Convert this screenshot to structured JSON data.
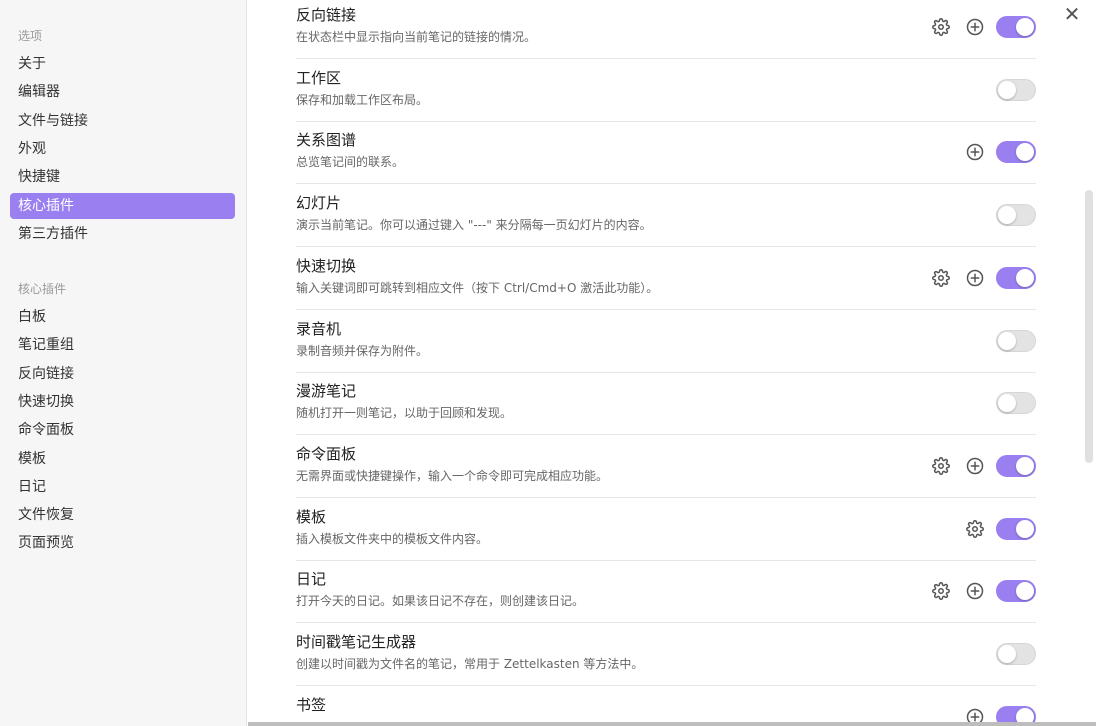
{
  "sidebar": {
    "options_heading": "选项",
    "options": [
      {
        "label": "关于",
        "active": false
      },
      {
        "label": "编辑器",
        "active": false
      },
      {
        "label": "文件与链接",
        "active": false
      },
      {
        "label": "外观",
        "active": false
      },
      {
        "label": "快捷键",
        "active": false
      },
      {
        "label": "核心插件",
        "active": true
      },
      {
        "label": "第三方插件",
        "active": false
      }
    ],
    "plugins_heading": "核心插件",
    "plugins": [
      "白板",
      "笔记重组",
      "反向链接",
      "快速切换",
      "命令面板",
      "模板",
      "日记",
      "文件恢复",
      "页面预览"
    ]
  },
  "plugins": [
    {
      "name": "反向链接",
      "desc": "在状态栏中显示指向当前笔记的链接的情况。",
      "settings": true,
      "add": true,
      "enabled": true
    },
    {
      "name": "工作区",
      "desc": "保存和加载工作区布局。",
      "settings": false,
      "add": false,
      "enabled": false
    },
    {
      "name": "关系图谱",
      "desc": "总览笔记间的联系。",
      "settings": false,
      "add": true,
      "enabled": true
    },
    {
      "name": "幻灯片",
      "desc": "演示当前笔记。你可以通过键入 \"---\" 来分隔每一页幻灯片的内容。",
      "settings": false,
      "add": false,
      "enabled": false
    },
    {
      "name": "快速切换",
      "desc": "输入关键词即可跳转到相应文件（按下 Ctrl/Cmd+O 激活此功能）。",
      "settings": true,
      "add": true,
      "enabled": true
    },
    {
      "name": "录音机",
      "desc": "录制音频并保存为附件。",
      "settings": false,
      "add": false,
      "enabled": false
    },
    {
      "name": "漫游笔记",
      "desc": "随机打开一则笔记，以助于回顾和发现。",
      "settings": false,
      "add": false,
      "enabled": false
    },
    {
      "name": "命令面板",
      "desc": "无需界面或快捷键操作，输入一个命令即可完成相应功能。",
      "settings": true,
      "add": true,
      "enabled": true
    },
    {
      "name": "模板",
      "desc": "插入模板文件夹中的模板文件内容。",
      "settings": true,
      "add": false,
      "enabled": true
    },
    {
      "name": "日记",
      "desc": "打开今天的日记。如果该日记不存在，则创建该日记。",
      "settings": true,
      "add": true,
      "enabled": true
    },
    {
      "name": "时间戳笔记生成器",
      "desc": "创建以时间戳为文件名的笔记，常用于 Zettelkasten 等方法中。",
      "settings": false,
      "add": false,
      "enabled": false
    },
    {
      "name": "书签",
      "desc": "",
      "settings": false,
      "add": true,
      "enabled": true
    }
  ],
  "icons": {
    "close": "close-icon",
    "settings": "gear-icon",
    "add": "plus-circle-icon"
  },
  "colors": {
    "accent": "#9a7ff0",
    "toggle_off": "#e3e3e3"
  }
}
